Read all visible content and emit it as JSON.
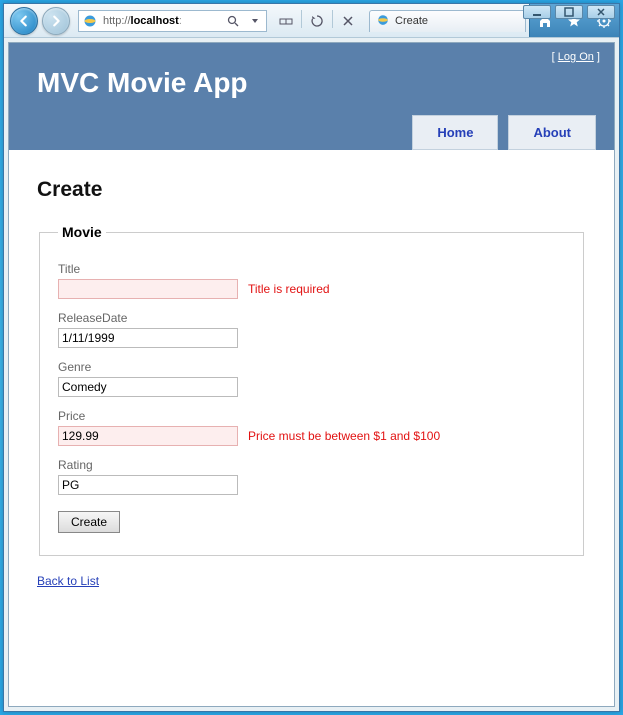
{
  "window": {
    "minimize_alt": "Minimize",
    "maximize_alt": "Maximize",
    "close_alt": "Close"
  },
  "toolbar": {
    "address_prefix": "http://",
    "address_host": "localhost",
    "back_alt": "Back",
    "forward_alt": "Forward",
    "search_alt": "Search",
    "dropdown_alt": "Recent",
    "compat_alt": "Compatibility View",
    "refresh_alt": "Refresh",
    "stop_alt": "Stop"
  },
  "tab": {
    "title": "Create"
  },
  "command": {
    "home_alt": "Home",
    "favorites_alt": "Favorites",
    "tools_alt": "Tools"
  },
  "page": {
    "logon_prefix": "[ ",
    "logon_link": "Log On",
    "logon_suffix": " ]",
    "app_title": "MVC Movie App",
    "menu": {
      "home": "Home",
      "about": "About"
    },
    "heading": "Create",
    "legend": "Movie",
    "fields": {
      "title": {
        "label": "Title",
        "value": "",
        "error": "Title is required"
      },
      "date": {
        "label": "ReleaseDate",
        "value": "1/11/1999",
        "error": ""
      },
      "genre": {
        "label": "Genre",
        "value": "Comedy",
        "error": ""
      },
      "price": {
        "label": "Price",
        "value": "129.99",
        "error": "Price must be between $1 and $100"
      },
      "rating": {
        "label": "Rating",
        "value": "PG",
        "error": ""
      }
    },
    "submit_label": "Create",
    "back_link": "Back to List"
  }
}
